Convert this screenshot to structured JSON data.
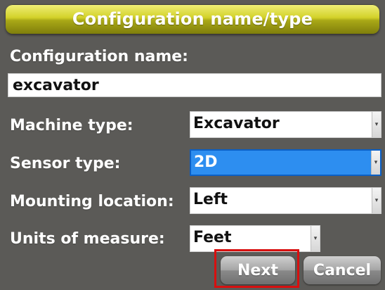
{
  "title": "Configuration name/type",
  "config_name": {
    "label": "Configuration name:",
    "value": "excavator"
  },
  "fields": [
    {
      "label": "Machine type:",
      "value": "Excavator"
    },
    {
      "label": "Sensor type:",
      "value": "2D"
    },
    {
      "label": "Mounting location:",
      "value": "Left"
    },
    {
      "label": "Units of measure:",
      "value": "Feet"
    }
  ],
  "buttons": {
    "next": "Next",
    "cancel": "Cancel"
  },
  "icons": {
    "dropdown_arrow": "chevron-down-icon"
  },
  "colors": {
    "title_bar": "#d3d22a",
    "selected_field": "#2d8ef0",
    "highlight_box": "#d80f0f",
    "background": "#5b5a57"
  }
}
